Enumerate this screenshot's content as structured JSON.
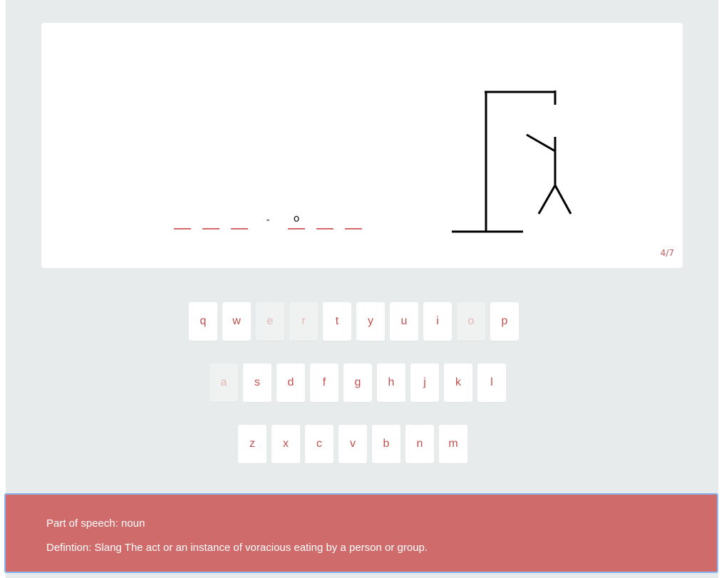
{
  "game": {
    "word_slots": [
      "",
      "",
      "",
      "-",
      "o",
      "",
      ""
    ],
    "slot_kinds": [
      "blank",
      "blank",
      "blank",
      "sep",
      "letter",
      "blank",
      "blank"
    ],
    "wrong_guess_counter": "4/7",
    "wrong_guesses": 4,
    "max_wrong_guesses": 7
  },
  "keyboard": {
    "rows": [
      [
        {
          "key": "q",
          "used": false
        },
        {
          "key": "w",
          "used": false
        },
        {
          "key": "e",
          "used": true
        },
        {
          "key": "r",
          "used": true
        },
        {
          "key": "t",
          "used": false
        },
        {
          "key": "y",
          "used": false
        },
        {
          "key": "u",
          "used": false
        },
        {
          "key": "i",
          "used": false
        },
        {
          "key": "o",
          "used": true
        },
        {
          "key": "p",
          "used": false
        }
      ],
      [
        {
          "key": "a",
          "used": true
        },
        {
          "key": "s",
          "used": false
        },
        {
          "key": "d",
          "used": false
        },
        {
          "key": "f",
          "used": false
        },
        {
          "key": "g",
          "used": false
        },
        {
          "key": "h",
          "used": false
        },
        {
          "key": "j",
          "used": false
        },
        {
          "key": "k",
          "used": false
        },
        {
          "key": "l",
          "used": false
        }
      ],
      [
        {
          "key": "z",
          "used": false
        },
        {
          "key": "x",
          "used": false
        },
        {
          "key": "c",
          "used": false
        },
        {
          "key": "v",
          "used": false
        },
        {
          "key": "b",
          "used": false
        },
        {
          "key": "n",
          "used": false
        },
        {
          "key": "m",
          "used": false
        }
      ]
    ]
  },
  "hint": {
    "part_of_speech": "Part of speech: noun",
    "definition": "Defintion: Slang The act or an instance of voracious eating by a person or group."
  },
  "colors": {
    "accent": "#c0504d",
    "panel": "#d06b6b",
    "background": "#e8ebec"
  }
}
